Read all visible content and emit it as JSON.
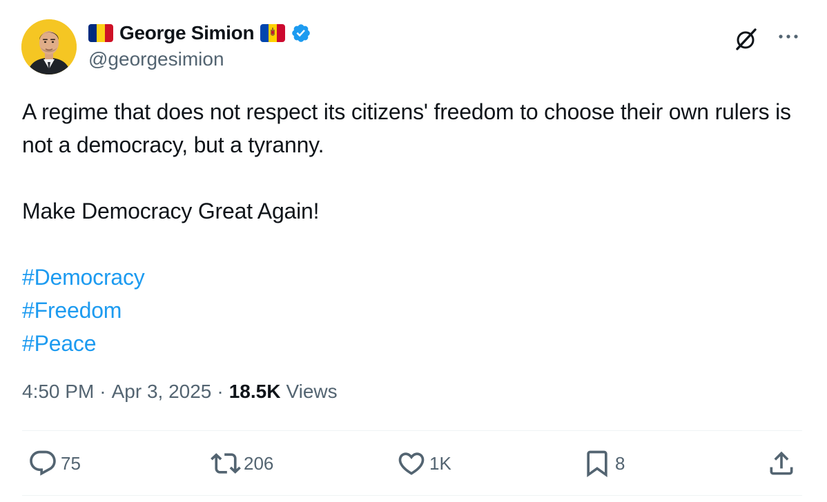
{
  "author": {
    "display_name": "George Simion",
    "handle": "@georgesimion",
    "verified": true,
    "flags": [
      "romania-flag",
      "moldova-flag"
    ]
  },
  "tweet": {
    "paragraph_1": "A regime that does not respect its citizens' freedom to choose their own rulers is not a democracy, but a tyranny.",
    "paragraph_2": "Make Democracy Great Again!",
    "hashtags": [
      "#Democracy",
      "#Freedom",
      "#Peace"
    ]
  },
  "meta": {
    "time": "4:50 PM",
    "separator": "·",
    "date": "Apr 3, 2025",
    "views_count": "18.5K",
    "views_label": "Views"
  },
  "actions": {
    "replies": "75",
    "reposts": "206",
    "likes": "1K",
    "bookmarks": "8"
  },
  "icons": {
    "grok": "grok-icon",
    "more": "more-icon",
    "reply": "reply-icon",
    "repost": "repost-icon",
    "like": "heart-icon",
    "bookmark": "bookmark-icon",
    "share": "share-icon",
    "verified": "verified-badge-icon"
  },
  "colors": {
    "text": "#0f1419",
    "secondary": "#536471",
    "link": "#1d9bf0",
    "verified": "#1d9bf0",
    "divider": "#eff3f4"
  }
}
